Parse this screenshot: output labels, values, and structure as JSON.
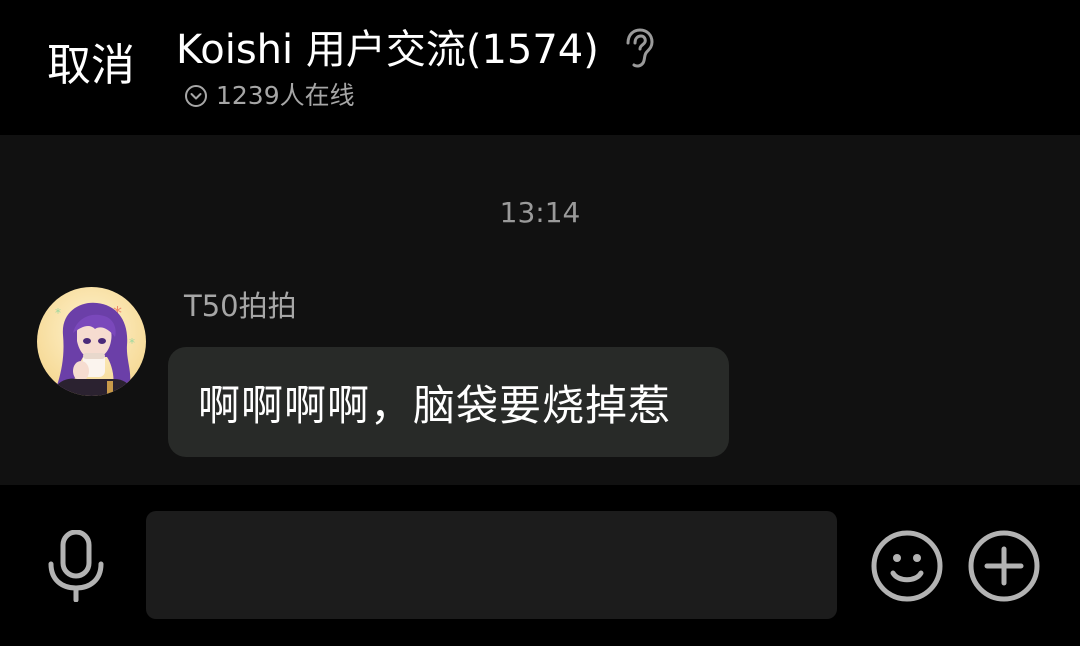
{
  "header": {
    "cancel_label": "取消",
    "title": "Koishi 用户交流(1574)",
    "online_text": "1239人在线",
    "ear_icon": "ear-icon",
    "online_icon": "chevron-down-circle-icon"
  },
  "chat": {
    "timestamp": "13:14",
    "messages": [
      {
        "sender": "T50拍拍",
        "avatar": "avatar-purple-hair-anime-girl",
        "text": "啊啊啊啊，脑袋要烧掉惹"
      }
    ]
  },
  "input": {
    "value": "",
    "placeholder": "",
    "mic_icon": "microphone-icon",
    "emoji_icon": "smiley-icon",
    "plus_icon": "plus-circle-icon"
  },
  "colors": {
    "background": "#000000",
    "chat_background": "#111111",
    "bubble": "#282a28",
    "muted_text": "#a6a6a6",
    "icon_gray": "#b3b3b3"
  }
}
